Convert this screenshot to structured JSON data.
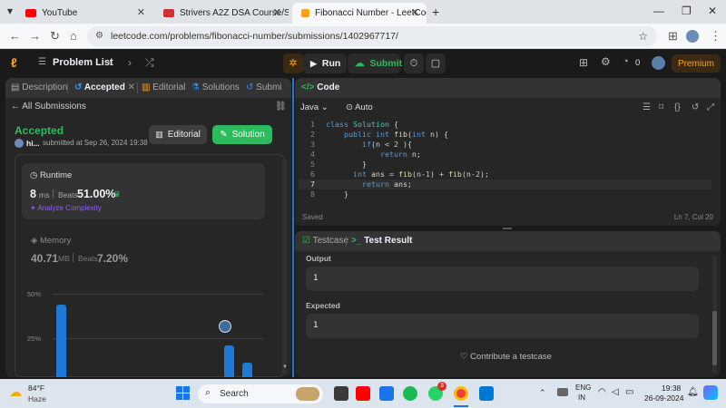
{
  "browser": {
    "tabs": [
      {
        "title": "YouTube",
        "color": "#ff0000"
      },
      {
        "title": "Strivers A2Z DSA Course/Sheet",
        "color": "#d32f2f"
      },
      {
        "title": "Fibonacci Number - LeetCode",
        "color": "#ffa116"
      }
    ],
    "new_tab": "+",
    "url": "leetcode.com/problems/fibonacci-number/submissions/1402967717/"
  },
  "lc_nav": {
    "problem_list": "Problem List",
    "run": "Run",
    "submit": "Submit",
    "notif_count": "0",
    "premium": "Premium"
  },
  "left_panel": {
    "tabs": [
      "Description",
      "Accepted",
      "Editorial",
      "Solutions",
      "Submi"
    ],
    "back": "All Submissions",
    "status": "Accepted",
    "user": "hi...",
    "submitted": "submitted at Sep 26, 2024 19:38",
    "editorial_btn": "Editorial",
    "solution_btn": "Solution",
    "runtime": {
      "label": "Runtime",
      "value": "8",
      "unit": "ms",
      "beats_label": "Beats",
      "beats": "51.00%",
      "analyze": "Analyze Complexity"
    },
    "memory": {
      "label": "Memory",
      "value": "40.71",
      "unit": "MB",
      "beats_label": "Beats",
      "beats": "7.20%"
    },
    "chart_data": {
      "type": "bar",
      "y_ticks": [
        "50%",
        "25%"
      ],
      "values_pct": [
        44,
        0,
        0,
        0,
        0,
        0,
        0,
        0,
        0,
        21,
        11
      ],
      "ylim": [
        0,
        50
      ],
      "highlight_index": 9
    }
  },
  "code_panel": {
    "title": "Code",
    "language": "Java",
    "mode": "Auto",
    "line_numbers": [
      "1",
      "2",
      "3",
      "4",
      "5",
      "6",
      "7",
      "8"
    ],
    "status_left": "Saved",
    "status_right": "Ln 7, Col 20"
  },
  "result_panel": {
    "tab_testcase": "Testcase",
    "tab_result": "Test Result",
    "output_label": "Output",
    "output_value": "1",
    "expected_label": "Expected",
    "expected_value": "1",
    "contribute": "Contribute a testcase"
  },
  "taskbar": {
    "weather_temp": "84°F",
    "weather_desc": "Haze",
    "search": "Search",
    "lang": "ENG",
    "region": "IN",
    "time": "19:38",
    "date": "26-09-2024",
    "badge": "3"
  }
}
